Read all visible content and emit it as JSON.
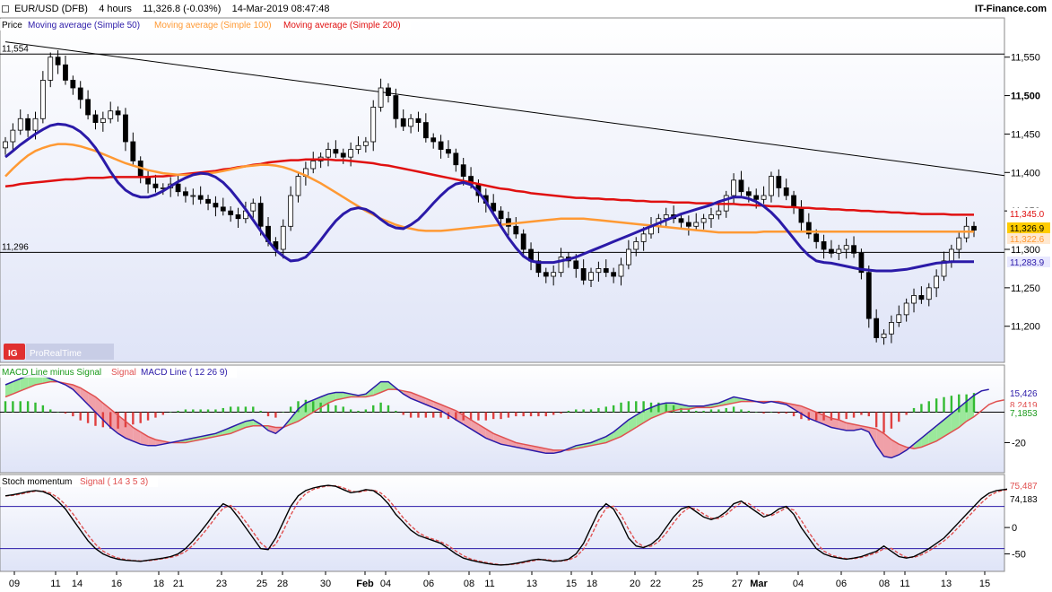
{
  "header": {
    "instrument": "EUR/USD (DFB)",
    "timeframe": "4 hours",
    "quote": "11,326.8 (-0.03%)",
    "datetime": "14-Mar-2019 08:47:48",
    "source": "IT-Finance.com"
  },
  "colors": {
    "sma50": "#2b1aa8",
    "sma100": "#ff9933",
    "sma200": "#e01010",
    "bull": "#ffffff",
    "bear": "#000000"
  },
  "chart_data": [
    {
      "type": "line",
      "panel": "price",
      "legend": [
        "Price",
        "Moving average (Simple 50)",
        "Moving average (Simple 100)",
        "Moving average (Simple 200)"
      ],
      "ylim": [
        11160,
        11580
      ],
      "yticks": [
        "11,550",
        "11,500",
        "11,450",
        "11,400",
        "11,350",
        "11,300",
        "11,250",
        "11,200"
      ],
      "ytick_values": [
        11550,
        11500,
        11450,
        11400,
        11350,
        11300,
        11250,
        11200
      ],
      "horizontal_levels": [
        {
          "label": "11,554",
          "value": 11554
        },
        {
          "label": "11,296",
          "value": 11296
        }
      ],
      "trendline": [
        [
          0,
          11570
        ],
        [
          140,
          11400
        ]
      ],
      "value_tags": [
        {
          "label": "11,345.0",
          "value": 11345.0,
          "series": "sma200"
        },
        {
          "label": "11,326.9",
          "value": 11326.9,
          "series": "price"
        },
        {
          "label": "11,322.6",
          "value": 11322.6,
          "series": "sma100"
        },
        {
          "label": "11,283.9",
          "value": 11283.9,
          "series": "sma50"
        }
      ],
      "brand": "ProRealTime",
      "close": [
        11440,
        11455,
        11470,
        11455,
        11470,
        11520,
        11550,
        11540,
        11520,
        11510,
        11495,
        11475,
        11465,
        11470,
        11480,
        11475,
        11440,
        11415,
        11395,
        11385,
        11380,
        11380,
        11385,
        11375,
        11370,
        11370,
        11365,
        11360,
        11355,
        11350,
        11345,
        11340,
        11350,
        11360,
        11330,
        11310,
        11300,
        11330,
        11370,
        11395,
        11405,
        11415,
        11420,
        11430,
        11425,
        11420,
        11430,
        11435,
        11440,
        11485,
        11510,
        11500,
        11470,
        11460,
        11470,
        11465,
        11445,
        11440,
        11430,
        11425,
        11410,
        11395,
        11385,
        11370,
        11360,
        11350,
        11340,
        11330,
        11320,
        11300,
        11285,
        11270,
        11265,
        11270,
        11290,
        11285,
        11275,
        11260,
        11270,
        11275,
        11270,
        11265,
        11280,
        11300,
        11310,
        11320,
        11330,
        11340,
        11345,
        11340,
        11335,
        11330,
        11335,
        11340,
        11345,
        11350,
        11370,
        11390,
        11375,
        11370,
        11365,
        11370,
        11395,
        11380,
        11370,
        11355,
        11335,
        11320,
        11310,
        11300,
        11295,
        11300,
        11305,
        11295,
        11270,
        11210,
        11185,
        11190,
        11205,
        11215,
        11230,
        11240,
        11235,
        11250,
        11265,
        11285,
        11300,
        11315,
        11330,
        11325
      ],
      "sma50": [
        11420,
        11428,
        11436,
        11443,
        11450,
        11456,
        11461,
        11463,
        11462,
        11459,
        11453,
        11444,
        11432,
        11417,
        11401,
        11387,
        11377,
        11371,
        11368,
        11368,
        11371,
        11376,
        11382,
        11388,
        11393,
        11397,
        11399,
        11398,
        11394,
        11387,
        11377,
        11365,
        11352,
        11338,
        11324,
        11311,
        11299,
        11291,
        11285,
        11286,
        11290,
        11300,
        11312,
        11325,
        11337,
        11346,
        11352,
        11354,
        11352,
        11347,
        11339,
        11332,
        11328,
        11327,
        11332,
        11339,
        11349,
        11360,
        11370,
        11379,
        11385,
        11387,
        11384,
        11375,
        11362,
        11346,
        11330,
        11315,
        11302,
        11291,
        11285,
        11283,
        11283,
        11283,
        11285,
        11287,
        11290,
        11294,
        11298,
        11302,
        11306,
        11310,
        11314,
        11318,
        11322,
        11326,
        11330,
        11334,
        11338,
        11342,
        11346,
        11349,
        11352,
        11355,
        11358,
        11362,
        11365,
        11368,
        11368,
        11366,
        11362,
        11356,
        11348,
        11338,
        11326,
        11314,
        11302,
        11292,
        11285,
        11283,
        11282,
        11280,
        11278,
        11276,
        11274,
        11273,
        11272,
        11272,
        11272,
        11273,
        11274,
        11276,
        11278,
        11280,
        11282,
        11283,
        11284,
        11284,
        11284,
        11284
      ],
      "sma100": [
        11395,
        11405,
        11414,
        11422,
        11428,
        11432,
        11435,
        11437,
        11437,
        11436,
        11434,
        11431,
        11428,
        11424,
        11420,
        11416,
        11412,
        11409,
        11406,
        11403,
        11401,
        11399,
        11398,
        11397,
        11397,
        11397,
        11398,
        11399,
        11400,
        11402,
        11404,
        11406,
        11408,
        11409,
        11410,
        11410,
        11409,
        11407,
        11404,
        11400,
        11396,
        11391,
        11386,
        11380,
        11374,
        11368,
        11362,
        11356,
        11350,
        11345,
        11340,
        11336,
        11332,
        11329,
        11327,
        11325,
        11324,
        11324,
        11324,
        11325,
        11326,
        11327,
        11328,
        11329,
        11330,
        11331,
        11332,
        11333,
        11334,
        11335,
        11336,
        11337,
        11338,
        11339,
        11340,
        11340,
        11340,
        11340,
        11339,
        11338,
        11337,
        11336,
        11335,
        11334,
        11333,
        11332,
        11331,
        11330,
        11329,
        11328,
        11327,
        11326,
        11325,
        11324,
        11323,
        11322,
        11322,
        11322,
        11322,
        11322,
        11322,
        11323,
        11323,
        11323,
        11323,
        11323,
        11323,
        11323,
        11323,
        11323,
        11323,
        11323,
        11323,
        11323,
        11323,
        11323,
        11323,
        11323,
        11323,
        11323,
        11323,
        11323,
        11323,
        11323,
        11323,
        11323,
        11323,
        11323,
        11323,
        11323
      ],
      "sma200": [
        11382,
        11383,
        11385,
        11386,
        11387,
        11388,
        11389,
        11390,
        11391,
        11391,
        11392,
        11393,
        11393,
        11393,
        11394,
        11394,
        11394,
        11394,
        11394,
        11394,
        11395,
        11395,
        11396,
        11397,
        11398,
        11399,
        11400,
        11401,
        11402,
        11404,
        11405,
        11407,
        11408,
        11410,
        11411,
        11413,
        11414,
        11415,
        11416,
        11416,
        11417,
        11417,
        11417,
        11417,
        11416,
        11416,
        11415,
        11414,
        11413,
        11412,
        11410,
        11409,
        11407,
        11405,
        11403,
        11401,
        11399,
        11397,
        11395,
        11393,
        11391,
        11389,
        11387,
        11385,
        11383,
        11381,
        11379,
        11378,
        11376,
        11375,
        11373,
        11372,
        11371,
        11370,
        11369,
        11368,
        11367,
        11367,
        11366,
        11366,
        11365,
        11365,
        11364,
        11364,
        11363,
        11363,
        11362,
        11362,
        11362,
        11361,
        11361,
        11361,
        11360,
        11360,
        11360,
        11359,
        11359,
        11359,
        11358,
        11358,
        11357,
        11357,
        11356,
        11356,
        11355,
        11355,
        11354,
        11354,
        11353,
        11353,
        11352,
        11352,
        11351,
        11351,
        11350,
        11350,
        11349,
        11349,
        11348,
        11348,
        11347,
        11347,
        11346,
        11346,
        11346,
        11346,
        11345,
        11345,
        11345,
        11345
      ]
    },
    {
      "type": "bar",
      "panel": "macd",
      "legend": [
        "MACD Line minus Signal",
        "Signal",
        "MACD Line ( 12 26 9)"
      ],
      "ylim": [
        -38,
        28
      ],
      "yticks": [
        "-20"
      ],
      "ytick_values": [
        -20
      ],
      "value_tags": [
        {
          "label": "15,426",
          "value": 15.426,
          "series": "macd"
        },
        {
          "label": "8,2419",
          "value": 8.2419,
          "series": "signal"
        },
        {
          "label": "7,1853",
          "value": 7.1853,
          "series": "hist"
        }
      ],
      "macd": [
        18,
        20,
        22,
        24,
        25,
        24,
        22,
        20,
        18,
        15,
        10,
        5,
        0,
        -5,
        -10,
        -14,
        -17,
        -19,
        -21,
        -22,
        -22,
        -21,
        -20,
        -19,
        -18,
        -17,
        -16,
        -15,
        -14,
        -12,
        -10,
        -8,
        -6,
        -5,
        -8,
        -12,
        -14,
        -10,
        -4,
        2,
        6,
        8,
        10,
        12,
        13,
        13,
        12,
        11,
        12,
        16,
        20,
        20,
        16,
        12,
        9,
        7,
        5,
        3,
        1,
        -2,
        -5,
        -8,
        -11,
        -14,
        -17,
        -19,
        -21,
        -22,
        -23,
        -24,
        -25,
        -26,
        -27,
        -27,
        -26,
        -24,
        -22,
        -21,
        -20,
        -18,
        -16,
        -13,
        -9,
        -5,
        -2,
        1,
        3,
        5,
        6,
        6,
        5,
        4,
        4,
        4,
        5,
        6,
        8,
        10,
        9,
        8,
        7,
        6,
        7,
        6,
        5,
        2,
        -1,
        -4,
        -6,
        -8,
        -10,
        -11,
        -12,
        -12,
        -11,
        -13,
        -22,
        -29,
        -30,
        -28,
        -25,
        -21,
        -17,
        -13,
        -9,
        -5,
        -1,
        3,
        7,
        11,
        14,
        15
      ],
      "signal": [
        10,
        12,
        14,
        16,
        18,
        19,
        20,
        20,
        19,
        18,
        16,
        13,
        10,
        6,
        2,
        -2,
        -6,
        -10,
        -13,
        -16,
        -18,
        -19,
        -20,
        -20,
        -20,
        -19,
        -18,
        -17,
        -16,
        -15,
        -14,
        -12,
        -10,
        -9,
        -9,
        -9,
        -10,
        -10,
        -8,
        -6,
        -3,
        0,
        3,
        6,
        8,
        9,
        10,
        10,
        10,
        11,
        13,
        15,
        15,
        14,
        13,
        11,
        9,
        7,
        5,
        3,
        1,
        -2,
        -5,
        -8,
        -11,
        -14,
        -16,
        -18,
        -20,
        -21,
        -22,
        -23,
        -24,
        -25,
        -25,
        -25,
        -24,
        -23,
        -22,
        -21,
        -20,
        -18,
        -16,
        -13,
        -10,
        -7,
        -4,
        -2,
        0,
        1,
        2,
        2,
        3,
        3,
        3,
        4,
        5,
        6,
        7,
        7,
        7,
        7,
        7,
        7,
        6,
        5,
        4,
        2,
        0,
        -2,
        -4,
        -5,
        -7,
        -8,
        -9,
        -10,
        -11,
        -14,
        -18,
        -21,
        -23,
        -24,
        -23,
        -21,
        -19,
        -16,
        -13,
        -10,
        -6,
        -3,
        1,
        5,
        7,
        8
      ]
    },
    {
      "type": "line",
      "panel": "stochastic",
      "legend": [
        "Stoch momentum",
        "Signal ( 14 3 5 3)"
      ],
      "ylim": [
        -78,
        92
      ],
      "yticks": [
        "0",
        "-50"
      ],
      "ytick_values": [
        0,
        -50
      ],
      "levels": [
        40,
        -40
      ],
      "value_tags": [
        {
          "label": "75,487",
          "value": 75.487,
          "series": "signal"
        },
        {
          "label": "74,183",
          "value": 74.183,
          "series": "stoch"
        }
      ],
      "stoch": [
        60,
        62,
        65,
        68,
        70,
        68,
        62,
        50,
        35,
        15,
        -5,
        -25,
        -40,
        -50,
        -56,
        -60,
        -62,
        -63,
        -64,
        -62,
        -60,
        -58,
        -55,
        -50,
        -40,
        -25,
        -8,
        10,
        30,
        45,
        38,
        20,
        0,
        -20,
        -40,
        -42,
        -20,
        10,
        40,
        60,
        70,
        75,
        78,
        80,
        78,
        72,
        66,
        68,
        72,
        70,
        60,
        45,
        25,
        10,
        -5,
        -15,
        -20,
        -25,
        -30,
        -40,
        -50,
        -58,
        -62,
        -65,
        -68,
        -70,
        -71,
        -70,
        -68,
        -65,
        -62,
        -60,
        -62,
        -64,
        -63,
        -60,
        -50,
        -30,
        0,
        30,
        45,
        35,
        10,
        -20,
        -35,
        -38,
        -32,
        -20,
        0,
        20,
        35,
        40,
        30,
        20,
        15,
        20,
        30,
        45,
        50,
        40,
        30,
        20,
        25,
        35,
        40,
        25,
        0,
        -20,
        -40,
        -50,
        -55,
        -58,
        -60,
        -58,
        -55,
        -50,
        -45,
        -35,
        -45,
        -55,
        -58,
        -55,
        -48,
        -40,
        -30,
        -20,
        -5,
        10,
        25,
        40,
        55,
        65,
        70,
        72,
        74
      ]
    }
  ],
  "x_axis": {
    "labels": [
      "09",
      "11",
      "14",
      "16",
      "18",
      "21",
      "23",
      "25",
      "28",
      "30",
      "Feb",
      "04",
      "06",
      "08",
      "11",
      "13",
      "15",
      "18",
      "20",
      "22",
      "25",
      "27",
      "Mar",
      "04",
      "06",
      "08",
      "11",
      "13",
      "15"
    ],
    "bold": [
      "Feb",
      "Mar"
    ]
  }
}
